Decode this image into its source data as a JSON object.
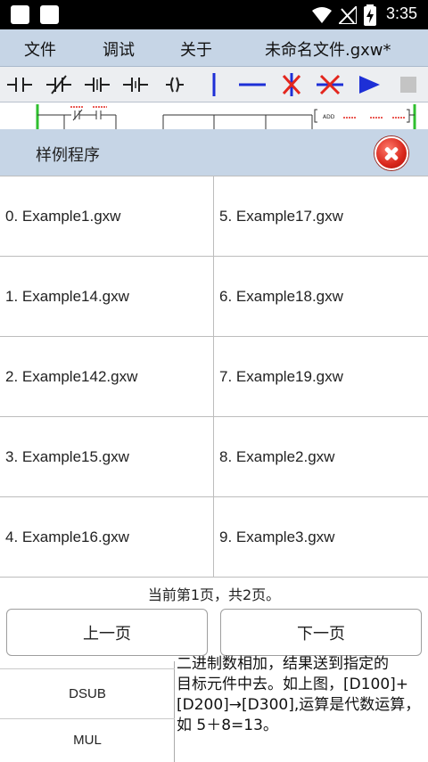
{
  "status": {
    "time": "3:35"
  },
  "menu": {
    "file": "文件",
    "debug": "调试",
    "about": "关于",
    "doc_title": "未命名文件.gxw*"
  },
  "toolbar": {
    "icons": [
      "normally-open-contact-icon",
      "normally-closed-contact-icon",
      "rising-edge-contact-icon",
      "falling-edge-contact-icon",
      "coil-icon",
      "vertical-line-icon",
      "horizontal-line-icon",
      "delete-vertical-line-icon",
      "delete-horizontal-line-icon",
      "run-icon",
      "stop-icon"
    ],
    "colors": {
      "blue": "#1d2fd6",
      "red": "#e3261e",
      "gray": "#c4c4c4"
    }
  },
  "ladder": {
    "instruction": "ADD"
  },
  "dialog": {
    "title": "样例程序",
    "files_left": [
      "0. Example1.gxw",
      "1. Example14.gxw",
      "2. Example142.gxw",
      "3. Example15.gxw",
      "4. Example16.gxw"
    ],
    "files_right": [
      "5. Example17.gxw",
      "6. Example18.gxw",
      "7. Example19.gxw",
      "8. Example2.gxw",
      "9. Example3.gxw"
    ],
    "page_info": "当前第1页，共2页。",
    "prev": "上一页",
    "next": "下一页"
  },
  "bottom": {
    "rows": [
      "DSUB",
      "MUL"
    ],
    "desc_line1": "二进制数相加，结果送到指定的",
    "desc_line2": "目标元件中去。如上图，[D100]+",
    "desc_line3": "[D200]→[D300],运算是代数运算，",
    "desc_line4": "如 5＋8=13。"
  }
}
